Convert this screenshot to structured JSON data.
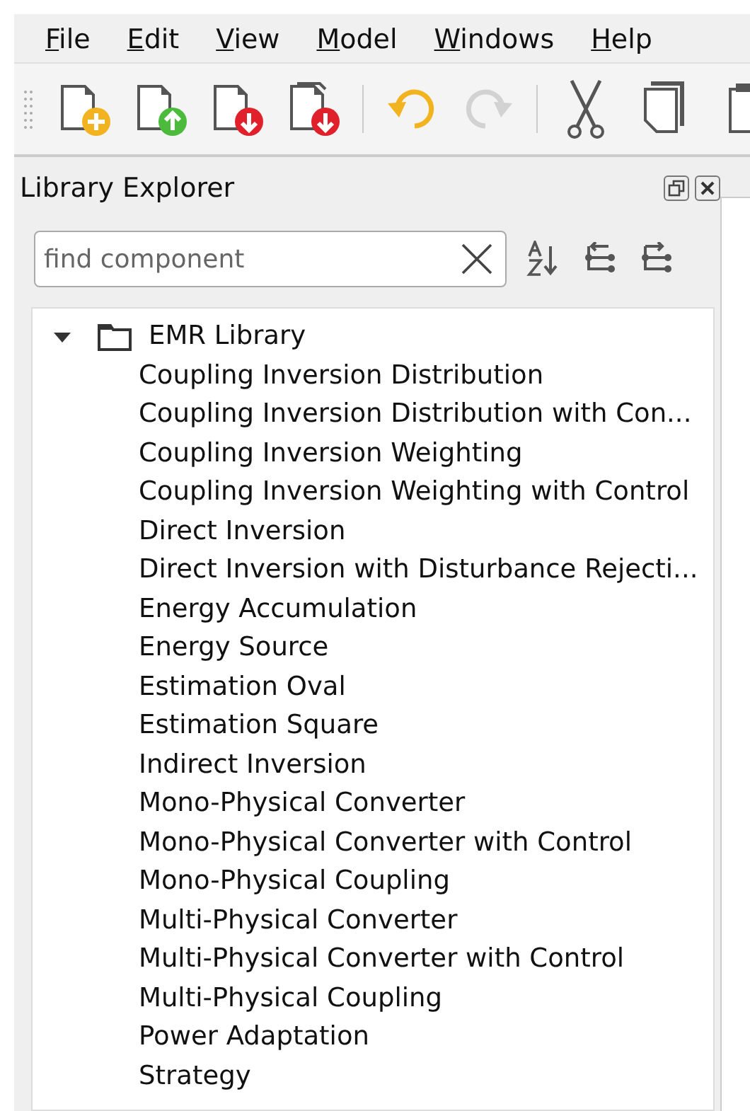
{
  "menu": [
    "File",
    "Edit",
    "View",
    "Model",
    "Windows",
    "Help"
  ],
  "toolbar": [
    {
      "kind": "new"
    },
    {
      "kind": "open"
    },
    {
      "kind": "save"
    },
    {
      "kind": "saveas"
    },
    {
      "kind": "sep"
    },
    {
      "kind": "undo",
      "disabled": false
    },
    {
      "kind": "redo",
      "disabled": true
    },
    {
      "kind": "sep"
    },
    {
      "kind": "cut"
    },
    {
      "kind": "copy"
    },
    {
      "kind": "paste"
    }
  ],
  "panel": {
    "title": "Library Explorer"
  },
  "search": {
    "placeholder": "find component"
  },
  "tree": [
    {
      "label": "EMR Library",
      "expanded": true,
      "children": [
        {
          "label": "Coupling Inversion Distribution"
        },
        {
          "label": "Coupling Inversion Distribution with Con..."
        },
        {
          "label": "Coupling Inversion Weighting"
        },
        {
          "label": "Coupling Inversion Weighting with Control"
        },
        {
          "label": "Direct Inversion"
        },
        {
          "label": "Direct Inversion with Disturbance Rejecti..."
        },
        {
          "label": "Energy Accumulation"
        },
        {
          "label": "Energy Source"
        },
        {
          "label": "Estimation Oval"
        },
        {
          "label": "Estimation Square"
        },
        {
          "label": "Indirect Inversion"
        },
        {
          "label": "Mono-Physical Converter"
        },
        {
          "label": "Mono-Physical Converter with Control"
        },
        {
          "label": "Mono-Physical Coupling"
        },
        {
          "label": "Multi-Physical Converter"
        },
        {
          "label": "Multi-Physical Converter with Control"
        },
        {
          "label": "Multi-Physical Coupling"
        },
        {
          "label": "Power Adaptation"
        },
        {
          "label": "Strategy"
        }
      ]
    }
  ]
}
